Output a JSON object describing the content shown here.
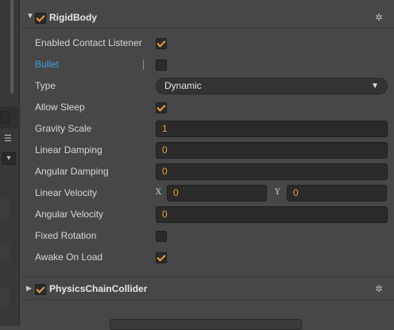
{
  "sidebar": {
    "menu_icon": "hamburger-icon",
    "dropdown_icon": "dropdown-icon"
  },
  "rigidbody": {
    "title": "RigidBody",
    "enabled": true,
    "expanded": true,
    "properties": {
      "enabled_contact_listener": {
        "label": "Enabled Contact Listener",
        "checked": true
      },
      "bullet": {
        "label": "Bullet",
        "checked": false
      },
      "type": {
        "label": "Type",
        "value": "Dynamic"
      },
      "allow_sleep": {
        "label": "Allow Sleep",
        "checked": true
      },
      "gravity_scale": {
        "label": "Gravity Scale",
        "value": "1"
      },
      "linear_damping": {
        "label": "Linear Damping",
        "value": "0"
      },
      "angular_damping": {
        "label": "Angular Damping",
        "value": "0"
      },
      "linear_velocity": {
        "label": "Linear Velocity",
        "x_label": "X",
        "x": "0",
        "y_label": "Y",
        "y": "0"
      },
      "angular_velocity": {
        "label": "Angular Velocity",
        "value": "0"
      },
      "fixed_rotation": {
        "label": "Fixed Rotation",
        "checked": false
      },
      "awake_on_load": {
        "label": "Awake On Load",
        "checked": true
      }
    }
  },
  "physics_chain_collider": {
    "title": "PhysicsChainCollider",
    "enabled": true,
    "expanded": false
  },
  "colors": {
    "accent": "#f0a03c",
    "link": "#3d9fe8",
    "panel": "#474747"
  }
}
